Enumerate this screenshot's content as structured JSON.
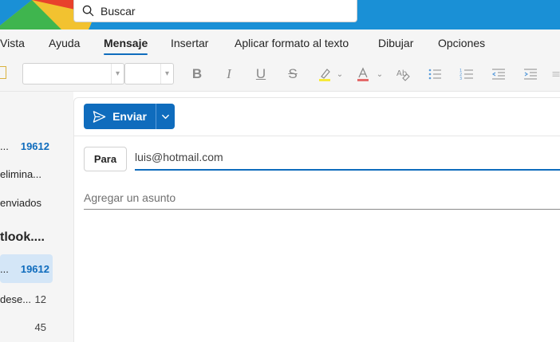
{
  "search": {
    "placeholder": "Buscar"
  },
  "ribbon": {
    "tabs": [
      "Vista",
      "Ayuda",
      "Mensaje",
      "Insertar",
      "Aplicar formato al texto",
      "Dibujar",
      "Opciones"
    ],
    "active_tab": "Mensaje"
  },
  "sidebar": {
    "folders": [
      {
        "name": "...",
        "count": "19612"
      },
      {
        "name": "elimina...",
        "count": ""
      },
      {
        "name": "enviados",
        "count": ""
      }
    ],
    "group_title": "tlook....",
    "group_folders": [
      {
        "name": "...",
        "count": "19612"
      },
      {
        "name": "dese...",
        "count": "12"
      },
      {
        "name": "",
        "count": "45"
      }
    ]
  },
  "compose": {
    "send_label": "Enviar",
    "to_label": "Para",
    "to_value": "luis@hotmail.com",
    "subject_placeholder": "Agregar un asunto"
  },
  "colors": {
    "brand": "#0f6cbd",
    "topbar": "#1a90d6",
    "selected_folder": "#d4e6f7"
  }
}
